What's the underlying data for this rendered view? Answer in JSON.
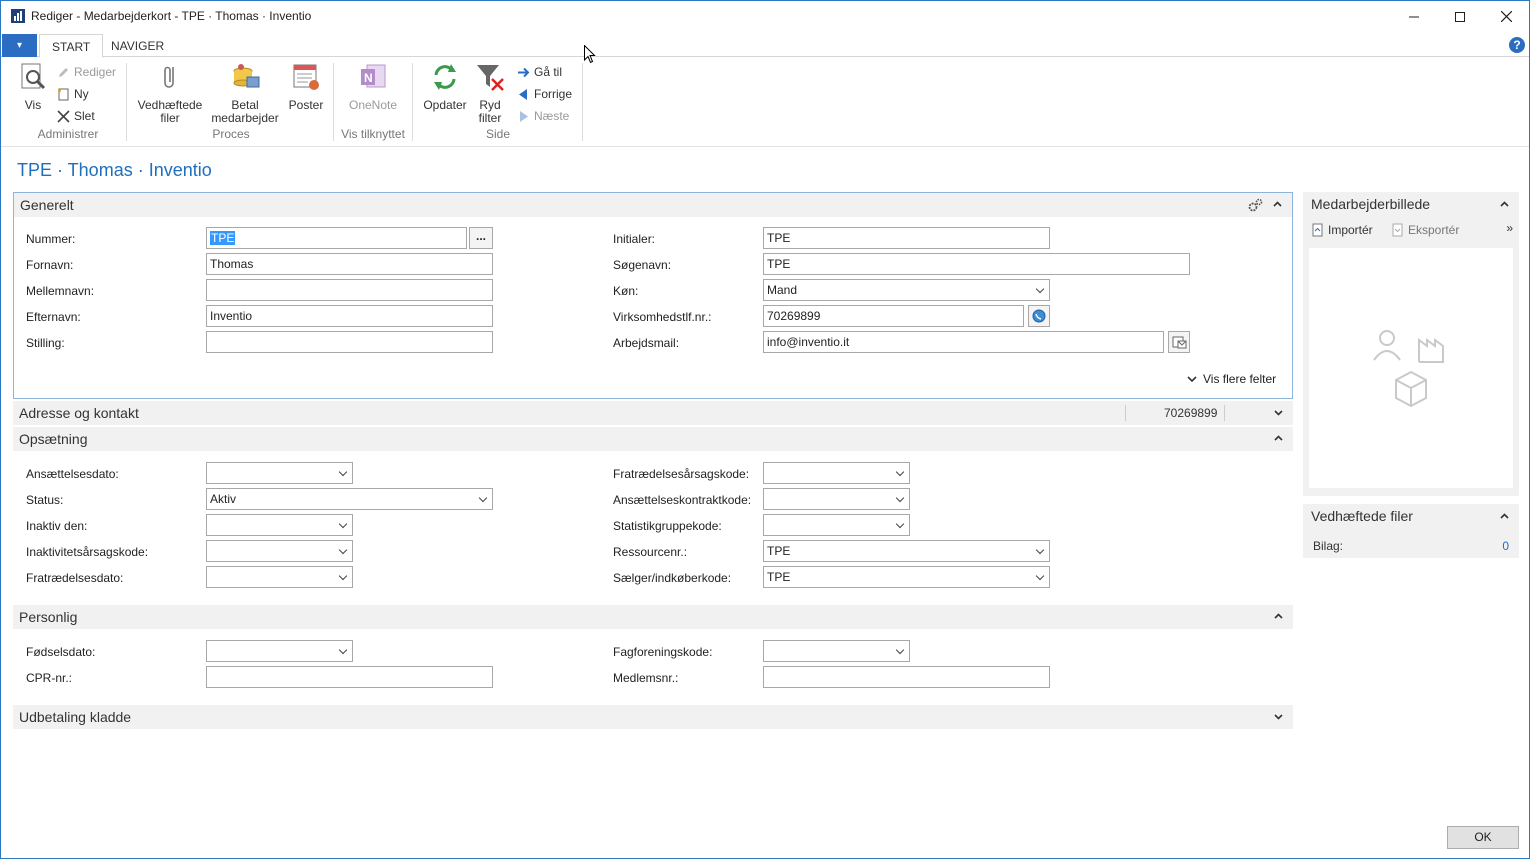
{
  "window": {
    "title": "Rediger - Medarbejderkort - TPE · Thomas  · Inventio",
    "minimize": "—",
    "maximize": "☐",
    "close": "✕"
  },
  "ribbon_tabs": {
    "menu_icon": "▾",
    "start": "START",
    "navigate": "NAVIGER",
    "help": "?"
  },
  "ribbon": {
    "groups": {
      "administrer": "Administrer",
      "proces": "Proces",
      "vis_tilknyttet": "Vis tilknyttet",
      "side": "Side"
    },
    "buttons": {
      "vis": "Vis",
      "rediger": "Rediger",
      "ny": "Ny",
      "slet": "Slet",
      "vedhaeftede_line1": "Vedhæftede",
      "vedhaeftede_line2": "filer",
      "betal_line1": "Betal",
      "betal_line2": "medarbejder",
      "poster": "Poster",
      "onenote": "OneNote",
      "opdater": "Opdater",
      "ryd_line1": "Ryd",
      "ryd_line2": "filter",
      "gaa_til": "Gå til",
      "forrige": "Forrige",
      "naeste": "Næste"
    }
  },
  "page_title": "TPE · Thomas  · Inventio",
  "general": {
    "header": "Generelt",
    "labels": {
      "nummer": "Nummer:",
      "fornavn": "Fornavn:",
      "mellemnavn": "Mellemnavn:",
      "efternavn": "Efternavn:",
      "stilling": "Stilling:",
      "initialer": "Initialer:",
      "soegenavn": "Søgenavn:",
      "koen": "Køn:",
      "virksomhedstlf": "Virksomhedstlf.nr.:",
      "arbejdsmail": "Arbejdsmail:"
    },
    "values": {
      "nummer": "TPE",
      "fornavn": "Thomas",
      "mellemnavn": "",
      "efternavn": "Inventio",
      "stilling": "",
      "initialer": "TPE",
      "soegenavn": "TPE",
      "koen": "Mand",
      "virksomhedstlf": "70269899",
      "arbejdsmail": "info@inventio.it"
    },
    "ellipsis": "...",
    "more_fields": "Vis flere felter"
  },
  "address": {
    "header": "Adresse og kontakt",
    "summary_phone": "70269899"
  },
  "setup": {
    "header": "Opsætning",
    "labels": {
      "ansaettelsesdato": "Ansættelsesdato:",
      "status": "Status:",
      "inaktiv_den": "Inaktiv den:",
      "inaktivitetsaarsagskode": "Inaktivitetsårsagskode:",
      "fratraedelsesdato": "Fratrædelsesdato:",
      "fratraedelsesaarsagskode": "Fratrædelsesårsagskode:",
      "ansaettelseskontraktkode": "Ansættelseskontraktkode:",
      "statistikgruppekode": "Statistikgruppekode:",
      "ressourcenr": "Ressourcenr.:",
      "saelger": "Sælger/indkøberkode:"
    },
    "values": {
      "ansaettelsesdato": "",
      "status": "Aktiv",
      "inaktiv_den": "",
      "inaktivitetsaarsagskode": "",
      "fratraedelsesdato": "",
      "fratraedelsesaarsagskode": "",
      "ansaettelseskontraktkode": "",
      "statistikgruppekode": "",
      "ressourcenr": "TPE",
      "saelger": "TPE"
    }
  },
  "personal": {
    "header": "Personlig",
    "labels": {
      "foedselsdato": "Fødselsdato:",
      "cpr": "CPR-nr.:",
      "fagforeningskode": "Fagforeningskode:",
      "medlemsnr": "Medlemsnr.:"
    },
    "values": {
      "foedselsdato": "",
      "cpr": "",
      "fagforeningskode": "",
      "medlemsnr": ""
    }
  },
  "payment": {
    "header": "Udbetaling kladde"
  },
  "factbox_picture": {
    "header": "Medarbejderbillede",
    "import": "Importér",
    "export": "Eksportér",
    "more": "»"
  },
  "factbox_attachments": {
    "header": "Vedhæftede filer",
    "label": "Bilag:",
    "count": "0"
  },
  "ok": "OK",
  "colors": {
    "accent": "#1e6fbd",
    "app_menu": "#2b6dc2",
    "section_bg": "#f1f1f1",
    "focus_border": "#8fb4dc"
  }
}
